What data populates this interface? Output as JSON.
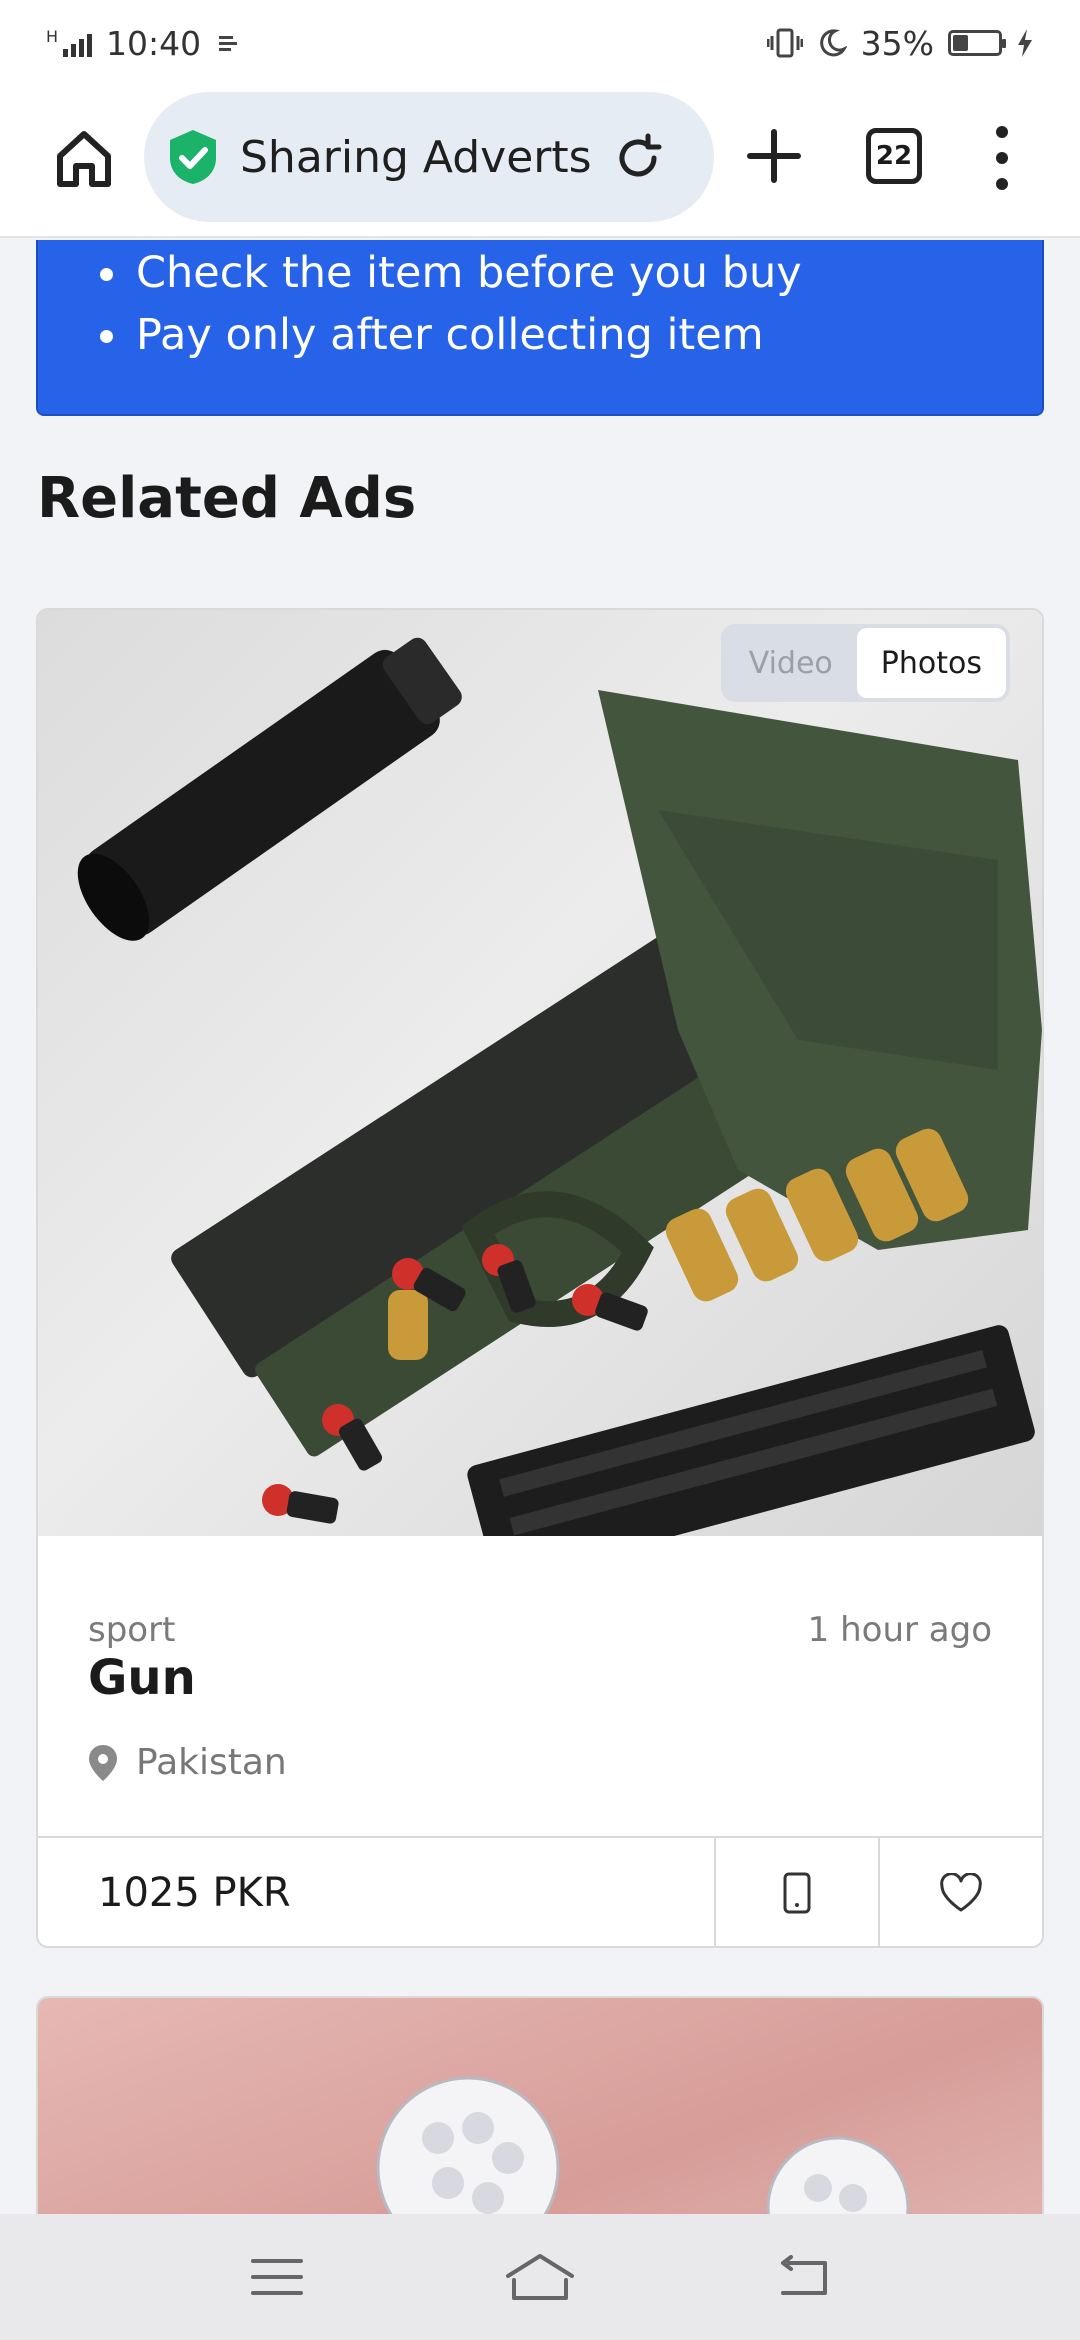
{
  "status_bar": {
    "time": "10:40",
    "network_label": "H",
    "battery_percent": "35%",
    "battery_level": 0.35
  },
  "browser": {
    "address_text": "Sharing Adverts",
    "tabs_count": "22",
    "icons": [
      "home-icon",
      "shield-check-icon",
      "reload-icon",
      "plus-icon",
      "tabs-icon",
      "more-vert-icon"
    ]
  },
  "safety_tips": [
    "Check the item before you buy",
    "Pay only after collecting item"
  ],
  "related": {
    "title": "Related Ads"
  },
  "ads": [
    {
      "media_toggle": {
        "video_label": "Video",
        "photos_label": "Photos",
        "selected": "Photos"
      },
      "category": "sport",
      "time_ago": "1 hour ago",
      "title": "Gun",
      "location": "Pakistan",
      "price": "1025 PKR"
    }
  ],
  "colors": {
    "banner": "#2763e8",
    "shield": "#1bb36a",
    "page_bg": "#f1f3f6"
  }
}
